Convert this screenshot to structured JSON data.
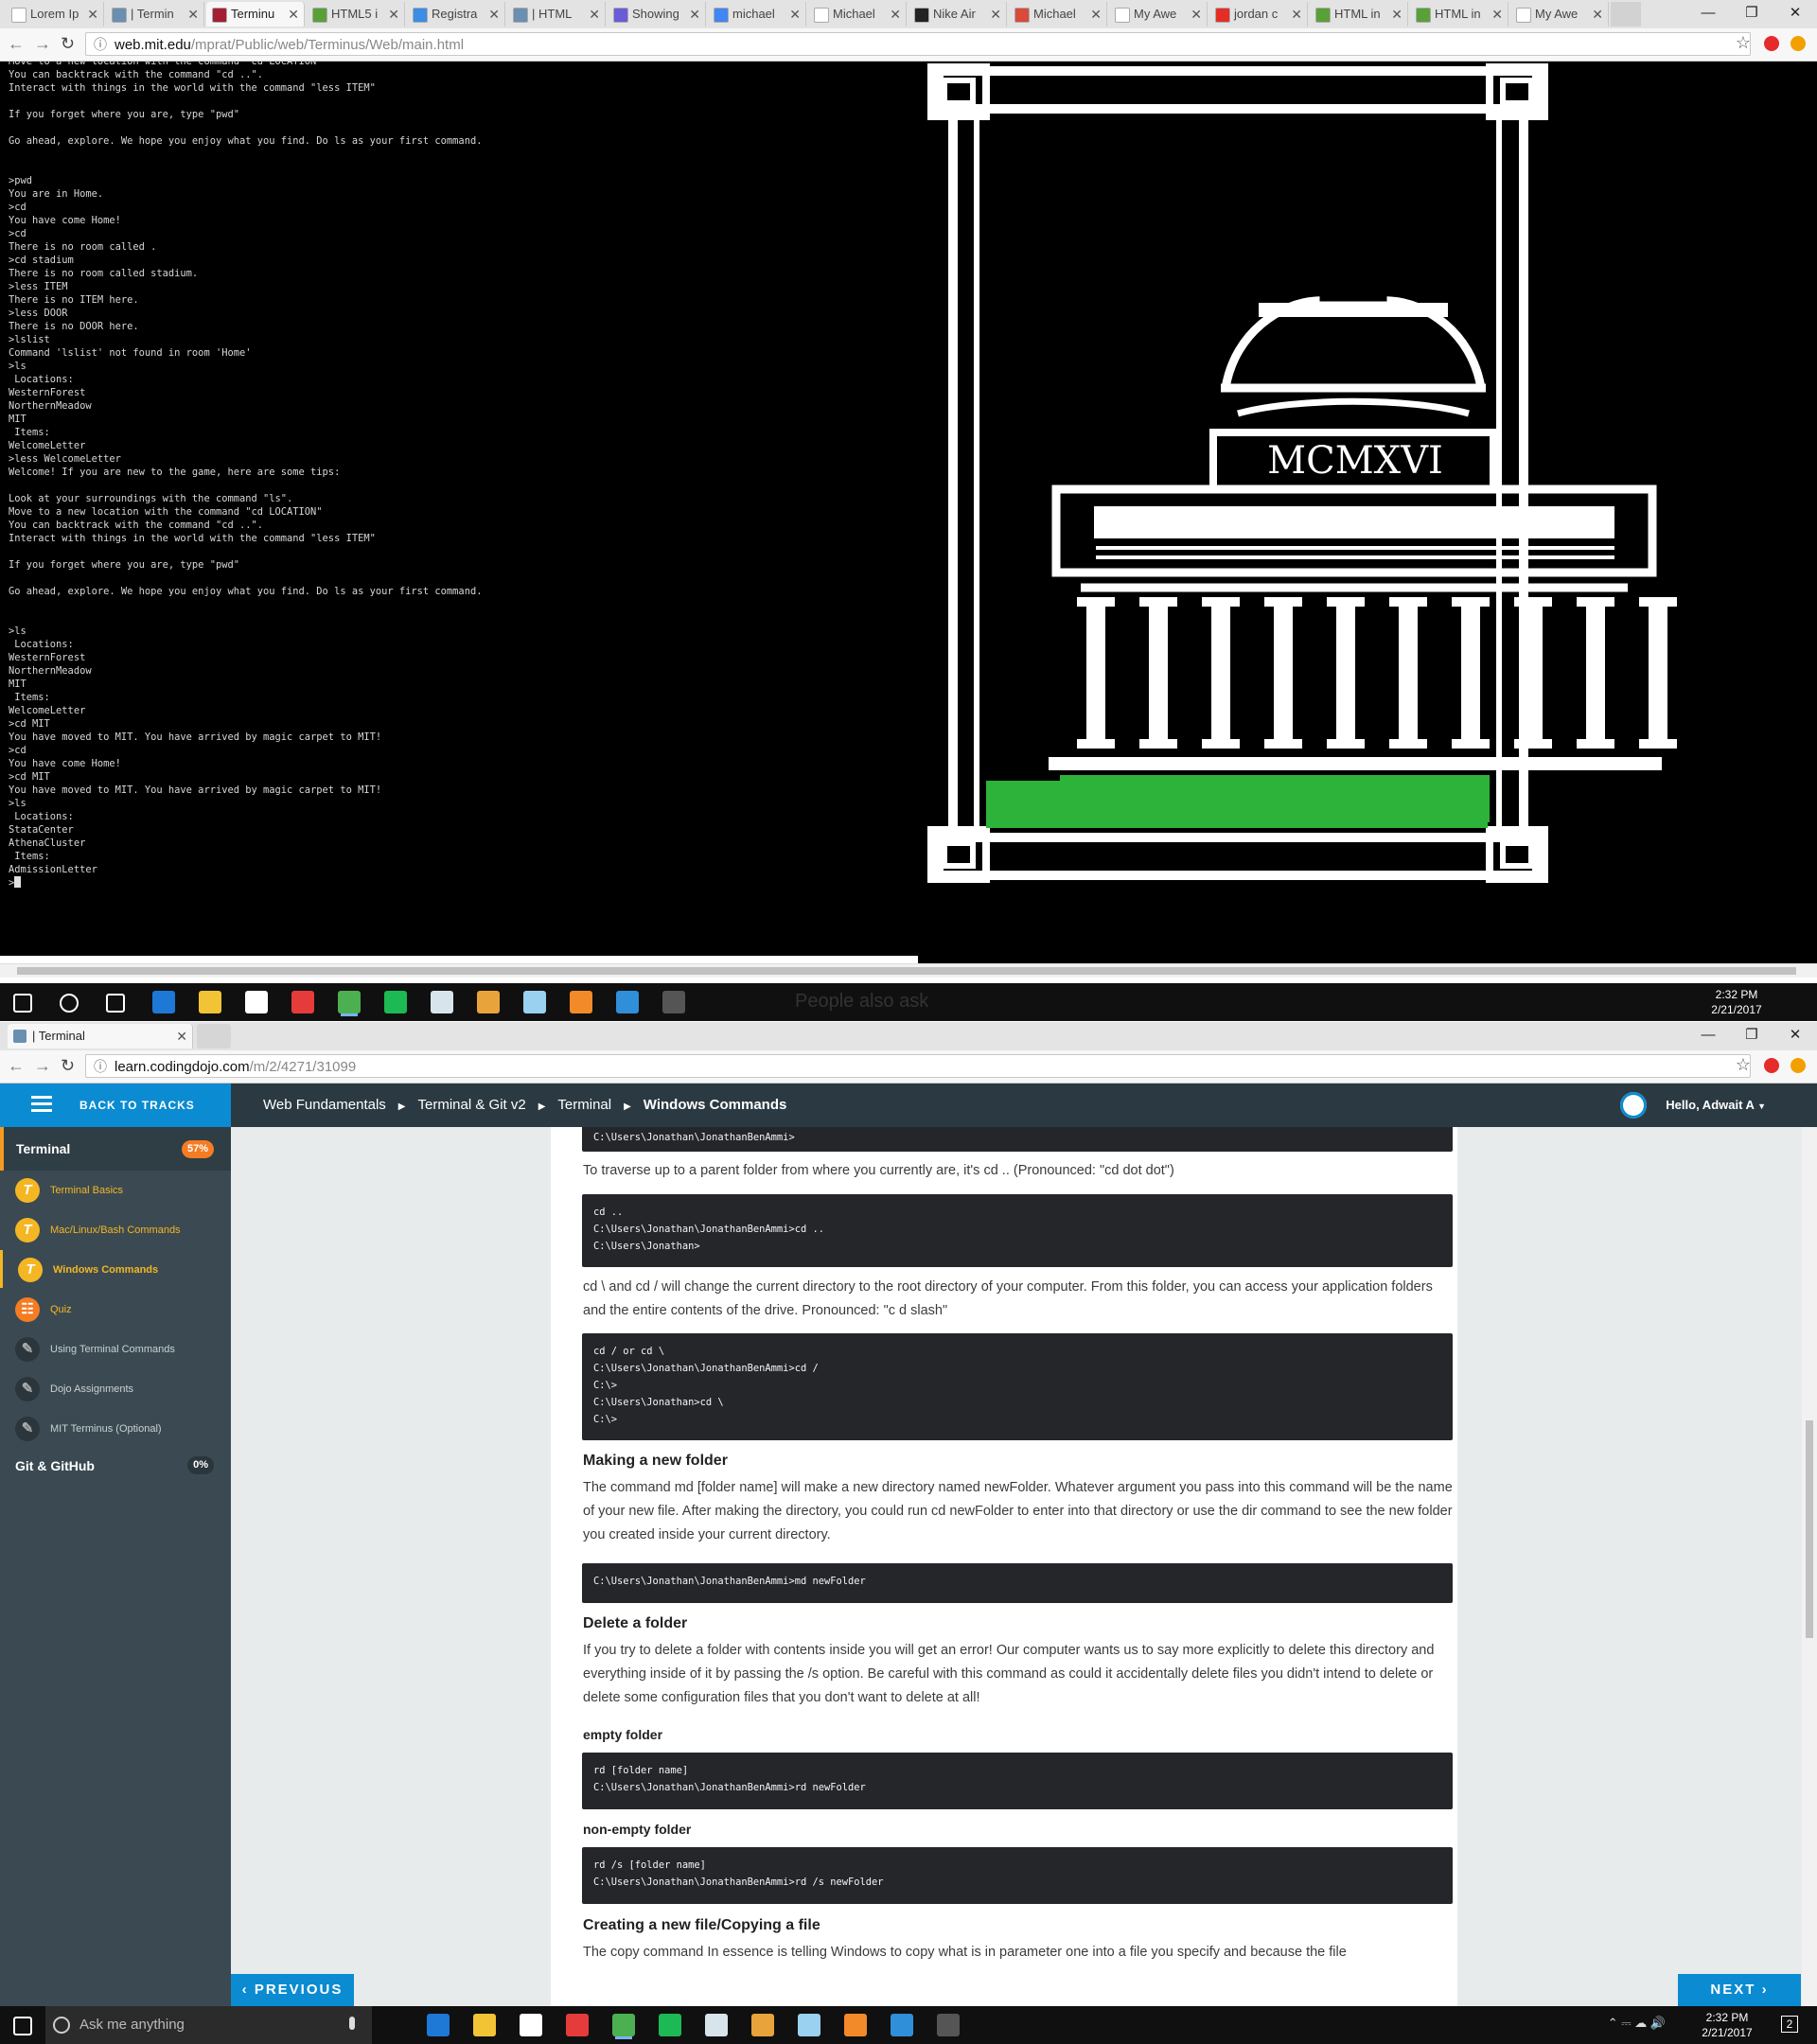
{
  "top_browser": {
    "tabs": [
      {
        "label": "Lorem Ip",
        "color": "#ffffff"
      },
      {
        "label": "| Termin",
        "color": "#6a8fb0"
      },
      {
        "label": "Terminu",
        "color": "#a31f34"
      },
      {
        "label": "HTML5 i",
        "color": "#58a037"
      },
      {
        "label": "Registra",
        "color": "#3c8de4"
      },
      {
        "label": "| HTML",
        "color": "#6a8fb0"
      },
      {
        "label": "Showing",
        "color": "#6a5bd6"
      },
      {
        "label": "michael",
        "color": "#4285f4"
      },
      {
        "label": "Michael",
        "color": "#ffffff"
      },
      {
        "label": "Nike Air",
        "color": "#222222"
      },
      {
        "label": "Michael",
        "color": "#d84a3a"
      },
      {
        "label": "My Awe",
        "color": "#ffffff"
      },
      {
        "label": "jordan c",
        "color": "#e52d27"
      },
      {
        "label": "HTML in",
        "color": "#58a037"
      },
      {
        "label": "HTML in",
        "color": "#58a037"
      },
      {
        "label": "My Awe",
        "color": "#ffffff"
      }
    ],
    "url_host": "web.mit.edu",
    "url_path": "/mprat/Public/web/Terminus/Web/main.html",
    "terminal_lines": [
      "Move to a new location with the command \"cd LOCATION\"",
      "You can backtrack with the command \"cd ..\".",
      "Interact with things in the world with the command \"less ITEM\"",
      "",
      "If you forget where you are, type \"pwd\"",
      "",
      "Go ahead, explore. We hope you enjoy what you find. Do ls as your first command.",
      "",
      "",
      ">pwd",
      "You are in Home.",
      ">cd",
      "You have come Home!",
      ">cd",
      "There is no room called .",
      ">cd stadium",
      "There is no room called stadium.",
      ">less ITEM",
      "There is no ITEM here.",
      ">less DOOR",
      "There is no DOOR here.",
      ">lslist",
      "Command 'lslist' not found in room 'Home'",
      ">ls",
      " Locations:",
      "WesternForest",
      "NorthernMeadow",
      "MIT",
      " Items:",
      "WelcomeLetter",
      ">less WelcomeLetter",
      "Welcome! If you are new to the game, here are some tips:",
      "",
      "Look at your surroundings with the command \"ls\".",
      "Move to a new location with the command \"cd LOCATION\"",
      "You can backtrack with the command \"cd ..\".",
      "Interact with things in the world with the command \"less ITEM\"",
      "",
      "If you forget where you are, type \"pwd\"",
      "",
      "Go ahead, explore. We hope you enjoy what you find. Do ls as your first command.",
      "",
      "",
      ">ls",
      " Locations:",
      "WesternForest",
      "NorthernMeadow",
      "MIT",
      " Items:",
      "WelcomeLetter",
      ">cd MIT",
      "You have moved to MIT. You have arrived by magic carpet to MIT!",
      ">cd",
      "You have come Home!",
      ">cd MIT",
      "You have moved to MIT. You have arrived by magic carpet to MIT!",
      ">ls",
      " Locations:",
      "StataCenter",
      "AthenaCluster",
      " Items:",
      "AdmissionLetter",
      ">"
    ],
    "mit_dome_text": "MCMXVI",
    "mit_colors": {
      "background": "#000000",
      "lines": "#ffffff",
      "grass": "#2db33a"
    }
  },
  "taskbar1": {
    "search_ghost_text": "People also ask",
    "time": "2:32 PM",
    "date": "2/21/2017"
  },
  "bottom_browser": {
    "tab_label": "| Terminal",
    "url_host": "learn.codingdojo.com",
    "url_path": "/m/2/4271/31099",
    "header": {
      "back_label": "BACK TO TRACKS",
      "breadcrumbs": [
        "Web Fundamentals",
        "Terminal & Git v2",
        "Terminal",
        "Windows Commands"
      ],
      "greeting": "Hello, Adwait A"
    },
    "sidebar": {
      "section_title": "Terminal",
      "section_progress": "57%",
      "items": [
        {
          "label": "Terminal Basics",
          "icon": "T",
          "state": "done"
        },
        {
          "label": "Mac/Linux/Bash Commands",
          "icon": "T",
          "state": "done"
        },
        {
          "label": "Windows Commands",
          "icon": "T",
          "state": "current"
        },
        {
          "label": "Quiz",
          "icon": "quiz",
          "state": "done"
        },
        {
          "label": "Using Terminal Commands",
          "icon": "pencil",
          "state": "todo"
        },
        {
          "label": "Dojo Assignments",
          "icon": "pencil",
          "state": "todo"
        },
        {
          "label": "MIT Terminus (Optional)",
          "icon": "pencil",
          "state": "todo"
        }
      ],
      "next_section_title": "Git & GitHub",
      "next_section_progress": "0%"
    },
    "article": {
      "top_code": "C:\\Users\\Jonathan\\JonathanBenAmmi>",
      "p_parent": "To traverse up to a parent folder from where you currently are, it's cd .. (Pronounced: \"cd dot dot\")",
      "code_parent": [
        "cd ..",
        "C:\\Users\\Jonathan\\JonathanBenAmmi>cd ..",
        "C:\\Users\\Jonathan>"
      ],
      "p_root": "cd \\ and cd / will change the current directory to the root directory of your computer. From this folder, you can access your application folders and the entire contents of the drive. Pronounced: \"c d slash\"",
      "code_root": [
        "cd / or cd \\",
        "C:\\Users\\Jonathan\\JonathanBenAmmi>cd /",
        "C:\\>",
        "C:\\Users\\Jonathan>cd \\",
        "C:\\>"
      ],
      "h_new_folder": "Making a new folder",
      "p_new_folder": "The command md [folder name] will make a new directory named  newFolder. Whatever argument you pass into this command will be the name of your new file. After making the directory, you could run cd newFolder to enter into that directory or use the dir command to see the new folder you created inside your current directory.",
      "code_md": [
        "C:\\Users\\Jonathan\\JonathanBenAmmi>md newFolder"
      ],
      "h_delete": "Delete a folder",
      "p_delete": "If you try to delete a folder with contents inside you will get an error! Our computer wants us to say more explicitly to delete this directory and everything inside of it by passing the  /s option. Be careful with this command as could it accidentally delete files you didn't intend to delete or delete some configuration files that you don't want to delete at all!",
      "h_empty": "empty folder",
      "code_empty": [
        "rd [folder name]",
        "C:\\Users\\Jonathan\\JonathanBenAmmi>rd newFolder"
      ],
      "h_nonempty": "non-empty folder",
      "code_nonempty": [
        "rd /s [folder name]",
        "C:\\Users\\Jonathan\\JonathanBenAmmi>rd /s newFolder"
      ],
      "h_copy": "Creating a new file/Copying a file",
      "p_copy": "The  copy command In essence is telling Windows to copy what is in parameter one into a file you specify and because the file"
    },
    "prev_label": "PREVIOUS",
    "next_label": "NEXT"
  },
  "taskbar2": {
    "search_placeholder": "Ask me anything",
    "time": "2:32 PM",
    "date": "2/21/2017",
    "notifications": "2"
  },
  "colors": {
    "accent": "#0b8bd1",
    "header": "#2b3a42",
    "sidebar": "#3b4a52",
    "progress": "#f47c23",
    "icon_done": "#f4b623"
  }
}
